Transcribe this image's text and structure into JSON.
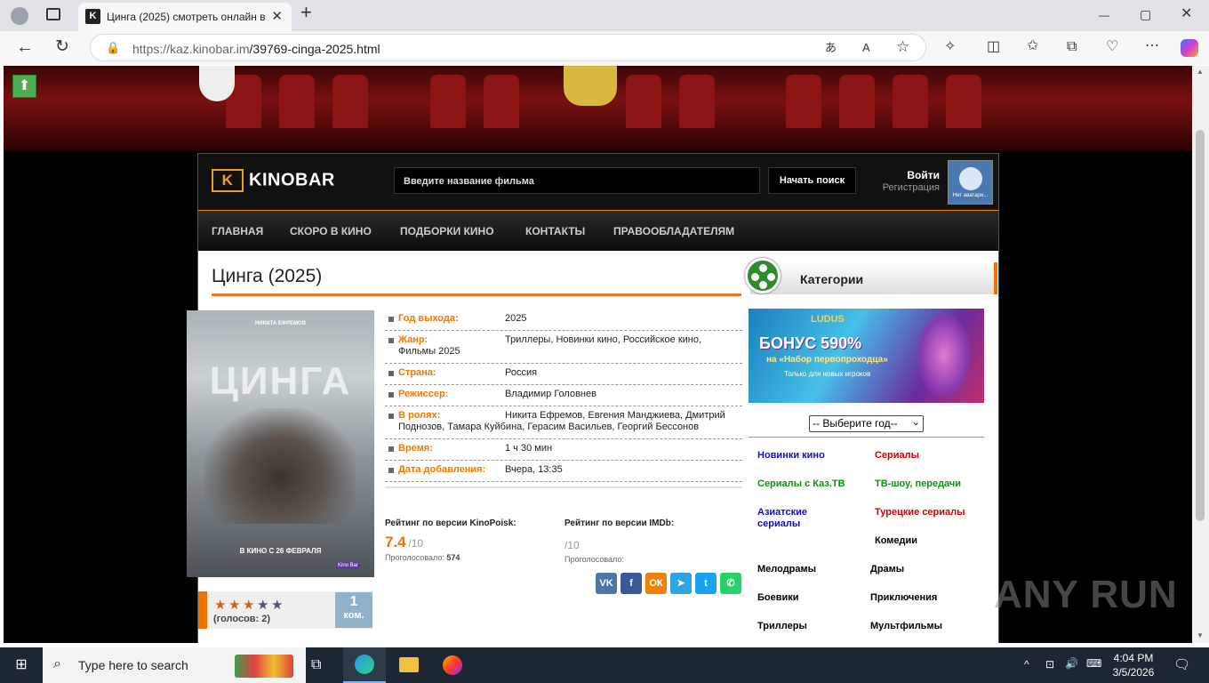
{
  "browser": {
    "tab_title": "Цинга (2025) смотреть онлайн в",
    "tab_close": "✕",
    "new_tab": "+",
    "url_host": "https://kaz.kinobar.im",
    "url_path": "/39769-cinga-2025.html",
    "window_min": "—",
    "window_max": "▢",
    "window_close": "✕"
  },
  "site": {
    "logo": "KINOBAR",
    "logo_mark": "K",
    "search_placeholder": "Введите название фильма",
    "search_button": "Начать поиск",
    "login": "Войти",
    "register": "Регистрация",
    "avatar_text": "Нет аватари...",
    "nav": [
      "ГЛАВНАЯ",
      "СКОРО В КИНО",
      "ПОДБОРКИ КИНО",
      "КОНТАКТЫ",
      "ПРАВООБЛАДАТЕЛЯМ"
    ],
    "up_arrow": "⬆"
  },
  "movie": {
    "title": "Цинга (2025)",
    "poster": {
      "actor": "НИКИТА ЕФРЕМОВ",
      "name": "ЦИНГА",
      "release": "В КИНО С 26 ФЕВРАЛЯ",
      "badge": "Kino Bar"
    },
    "info": [
      {
        "key": "Год выхода:",
        "value": "2025"
      },
      {
        "key": "Жанр:",
        "value": "Триллеры, Новинки кино, Российское кино,",
        "value2": "Фильмы 2025"
      },
      {
        "key": "Страна:",
        "value": "Россия"
      },
      {
        "key": "Режиссер:",
        "value": "Владимир Головнев"
      },
      {
        "key": "В ролях:",
        "value": "Никита Ефремов, Евгения Манджиева, Дмитрий",
        "value2": "Поднозов, Тамара Куйбина, Герасим Васильев, Георгий Бессонов"
      },
      {
        "key": "Время:",
        "value": "1 ч 30 мин"
      },
      {
        "key": "Дата добавления:",
        "value": "Вчера, 13:35"
      }
    ],
    "kp": {
      "label": "Рейтинг по версии KinoPoisk:",
      "score": "7.4",
      "of": "/10",
      "votes_label": "Проголосовало:",
      "votes": "574"
    },
    "imdb": {
      "label": "Рейтинг по версии IMDb:",
      "score": "",
      "of": "/10",
      "votes_label": "Проголосовало:",
      "votes": ""
    },
    "rating_stars": 3,
    "stars_glyph": "★",
    "votes_text": "(голосов: 2)",
    "comments_count": "1",
    "comments_label": "ком.",
    "share": [
      {
        "name": "vk",
        "label": "VK",
        "color": "#4a76a8"
      },
      {
        "name": "facebook",
        "label": "f",
        "color": "#3b5998"
      },
      {
        "name": "odnoklassniki",
        "label": "ОК",
        "color": "#ee8208"
      },
      {
        "name": "telegram",
        "label": "➤",
        "color": "#2ca5e0"
      },
      {
        "name": "twitter",
        "label": "t",
        "color": "#1da1f2"
      },
      {
        "name": "whatsapp",
        "label": "✆",
        "color": "#25d366"
      }
    ]
  },
  "sidebar": {
    "header": "Категории",
    "ad": {
      "logo": "LUDUS",
      "line1": "БОНУС 590%",
      "line2": "на «Набор первопроходца»",
      "line3": "Только для новых игроков"
    },
    "year_select": "-- Выберите год--",
    "categories": [
      {
        "label": "Новинки кино",
        "color": "#1010c0"
      },
      {
        "label": "Сериалы",
        "color": "#d00000"
      },
      {
        "label": "Сериалы с Каз.ТВ",
        "color": "#109010"
      },
      {
        "label": "ТВ-шоу, передачи",
        "color": "#109010"
      },
      {
        "label": "Азиатские",
        "label2": "сериалы",
        "color": "#1010c0"
      },
      {
        "label": "Турецкие сериалы",
        "color": "#d00000"
      },
      {
        "label": "Комедии",
        "color": "#000000"
      },
      {
        "label": "Мелодрамы",
        "color": "#000000"
      },
      {
        "label": "Драмы",
        "color": "#000000"
      },
      {
        "label": "Боевики",
        "color": "#000000"
      },
      {
        "label": "Приключения",
        "color": "#000000"
      },
      {
        "label": "Триллеры",
        "color": "#000000"
      },
      {
        "label": "Мультфильмы",
        "color": "#000000"
      }
    ]
  },
  "watermark": "ANY RUN",
  "taskbar": {
    "search_placeholder": "Type here to search",
    "time": "4:04 PM",
    "date": "3/5/2026"
  }
}
